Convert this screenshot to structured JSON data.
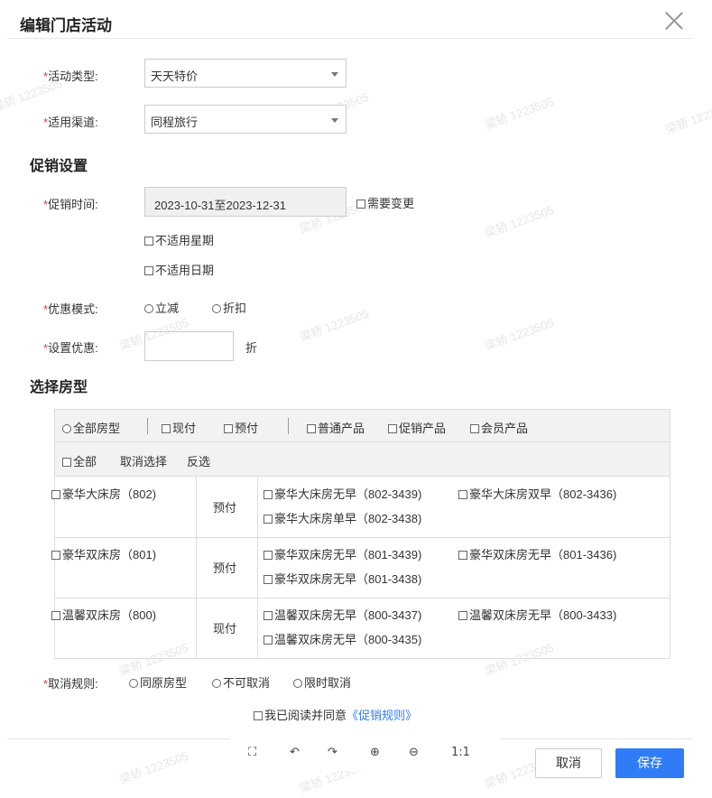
{
  "dialog": {
    "title": "编辑门店活动"
  },
  "form": {
    "activity_type": {
      "label": "活动类型:",
      "value": "天天特价"
    },
    "channel": {
      "label": "适用渠道:",
      "value": "同程旅行"
    },
    "promo_section": "促销设置",
    "promo_time": {
      "label": "促销时间:",
      "value": "2023-10-31至2023-12-31",
      "need_change": "需要变更",
      "exclude_weekday": "不适用星期",
      "exclude_date": "不适用日期"
    },
    "discount_mode": {
      "label": "优惠模式:",
      "options": [
        "立减",
        "折扣"
      ]
    },
    "set_discount": {
      "label": "设置优惠:",
      "value": "",
      "unit": "折"
    },
    "room_section": "选择房型",
    "room_filter": {
      "all_types": "全部房型",
      "now_pay": "现付",
      "prepay": "预付",
      "normal": "普通产品",
      "promo": "促销产品",
      "member": "会员产品"
    },
    "select_actions": {
      "all": "全部",
      "cancel": "取消选择",
      "invert": "反选"
    },
    "rooms": [
      {
        "name": "豪华大床房（802)",
        "pay": "预付",
        "products": [
          "豪华大床房无早（802-3439)",
          "豪华大床房双早（802-3436)",
          "豪华大床房单早（802-3438)"
        ]
      },
      {
        "name": "豪华双床房（801)",
        "pay": "预付",
        "products": [
          "豪华双床房无早（801-3439)",
          "豪华双床房无早（801-3436)",
          "豪华双床房无早（801-3438)"
        ]
      },
      {
        "name": "温馨双床房（800)",
        "pay": "现付",
        "products": [
          "温馨双床房无早（800-3437)",
          "温馨双床房无早（800-3433)",
          "温馨双床房无早（800-3435)"
        ]
      }
    ],
    "cancel_rule": {
      "label": "取消规则:",
      "options": [
        "同原房型",
        "不可取消",
        "限时取消"
      ]
    },
    "agreement": {
      "text": "我已阅读并同意",
      "link": "《促销规则》"
    }
  },
  "toolbar": {
    "fit": "⛶",
    "rotate_left": "↶",
    "rotate_right": "↷",
    "zoom_in": "⊕",
    "zoom_out": "⊖",
    "actual": "1:1"
  },
  "footer": {
    "cancel": "取消",
    "save": "保存"
  },
  "watermark": "梁轿 1223505",
  "colors": {
    "primary": "#2f7cf6",
    "required": "#e53935"
  }
}
